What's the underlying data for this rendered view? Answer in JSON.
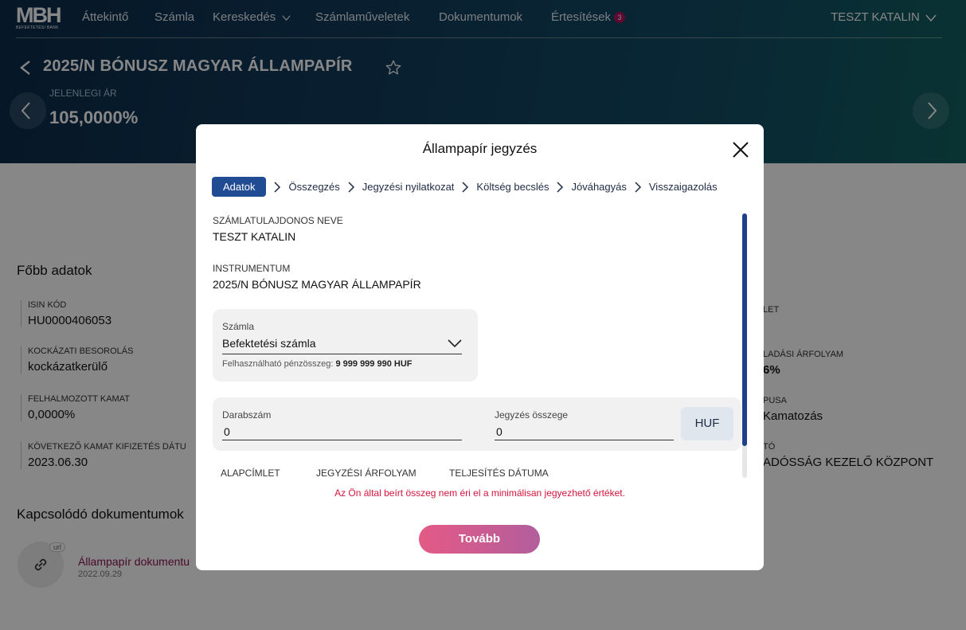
{
  "brand": {
    "logo_text": "MBH",
    "logo_subtext": "BEFEKTETÉSI BANK"
  },
  "nav": {
    "items": [
      {
        "label": "Áttekintő"
      },
      {
        "label": "Számla"
      },
      {
        "label": "Kereskedés"
      },
      {
        "label": "Számlaműveletek"
      },
      {
        "label": "Dokumentumok"
      },
      {
        "label": "Értesítések"
      }
    ],
    "notification_count": "3",
    "user_name": "TESZT KATALIN"
  },
  "instrument": {
    "title": "2025/N BÓNUSZ MAGYAR ÁLLAMPAPÍR",
    "price_label": "JELENLEGI ÁR",
    "price_value": "105,0000%"
  },
  "main": {
    "section_title": "Főbb adatok",
    "left_fields": [
      {
        "label": "ISIN KÓD",
        "value": "HU0000406053"
      },
      {
        "label": "KOCKÁZATI BESOROLÁS",
        "value": "kockázatkerülő"
      },
      {
        "label": "FELHALMOZOTT KAMAT",
        "value": "0,0000%"
      },
      {
        "label": "KÖVETKEZŐ KAMAT KIFIZETÉS DÁTU",
        "value": "2023.06.30"
      }
    ],
    "right_fields": [
      {
        "label": "LET",
        "value": ""
      },
      {
        "label": "LADÁSI ÁRFOLYAM",
        "value": "6%"
      },
      {
        "label": "PUSA",
        "value": "Kamatozás"
      },
      {
        "label": "TÓ",
        "value": "ADÓSSÁG KEZELŐ KÖZPONT"
      }
    ],
    "docs_title": "Kapcsolódó dokumentumok",
    "doc": {
      "tag": "url",
      "name": "Állampapír dokumentu",
      "date": "2022.09.29"
    }
  },
  "modal": {
    "title": "Állampapír jegyzés",
    "steps": [
      "Adatok",
      "Összegzés",
      "Jegyzési nyilatkozat",
      "Költség becslés",
      "Jóváhagyás",
      "Visszaigazolás"
    ],
    "owner_label": "SZÁMLATULAJDONOS NEVE",
    "owner_value": "TESZT KATALIN",
    "instrument_label": "INSTRUMENTUM",
    "instrument_value": "2025/N BÓNUSZ MAGYAR ÁLLAMPAPÍR",
    "account": {
      "label": "Számla",
      "selected": "Befektetési számla",
      "available_label": "Felhasználható pénzösszeg: ",
      "available_value": "9 999 999 990 HUF"
    },
    "quantity": {
      "label": "Darabszám",
      "value": "0"
    },
    "amount": {
      "label": "Jegyzés összege",
      "value": "0"
    },
    "currency": "HUF",
    "columns": [
      "ALAPCÍMLET",
      "JEGYZÉSI ÁRFOLYAM",
      "TELJESÍTÉS DÁTUMA"
    ],
    "error": "Az Ön által beírt összeg nem éri el a minimálisan jegyezhető értéket.",
    "next_label": "Tovább"
  },
  "colors": {
    "header_dark": "#0d2c4a",
    "header_teal": "#12605f",
    "active_step": "#214b93",
    "error": "#d4143c",
    "button_start": "#e45a85",
    "button_end": "#b25e9d",
    "badge": "#b0125b"
  }
}
